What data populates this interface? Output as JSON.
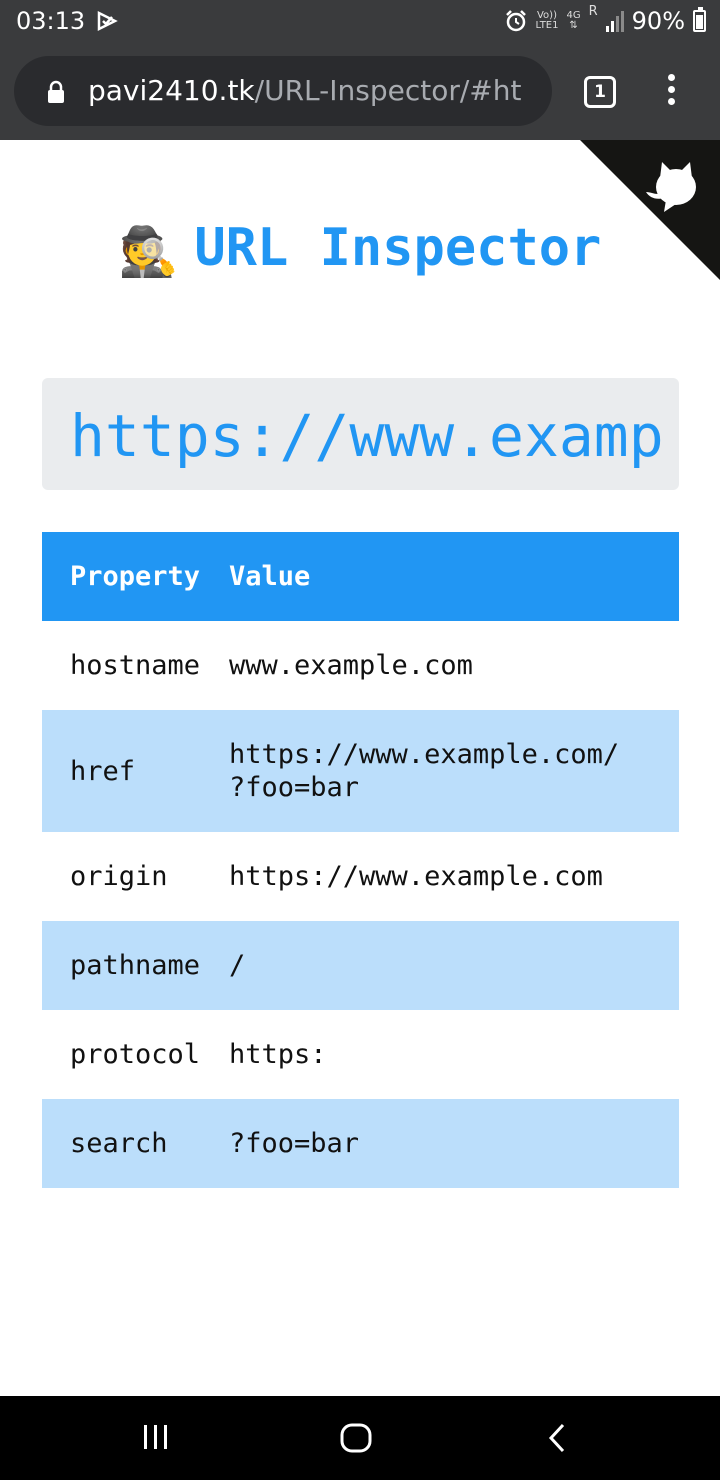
{
  "status_bar": {
    "time": "03:13",
    "volte": "Vo))",
    "lte": "LTE1",
    "network": "4G",
    "roaming": "R",
    "battery": "90%"
  },
  "browser": {
    "url_host": "pavi2410.tk",
    "url_rest": "/URL-Inspector/#ht",
    "tab_count": "1"
  },
  "page": {
    "title": "URL Inspector",
    "title_emoji": "🕵",
    "url_value": "https://www.examp",
    "accent_color": "#2196f3",
    "stripe_color": "#bbdefb",
    "table": {
      "headers": [
        "Property",
        "Value"
      ],
      "rows": [
        {
          "property": "hostname",
          "value": "www.example.com"
        },
        {
          "property": "href",
          "value": "https://www.example.com/",
          "value2": "?foo=bar"
        },
        {
          "property": "origin",
          "value": "https://www.example.com"
        },
        {
          "property": "pathname",
          "value": "/"
        },
        {
          "property": "protocol",
          "value": "https:"
        },
        {
          "property": "search",
          "value": "?foo=bar"
        }
      ]
    }
  }
}
